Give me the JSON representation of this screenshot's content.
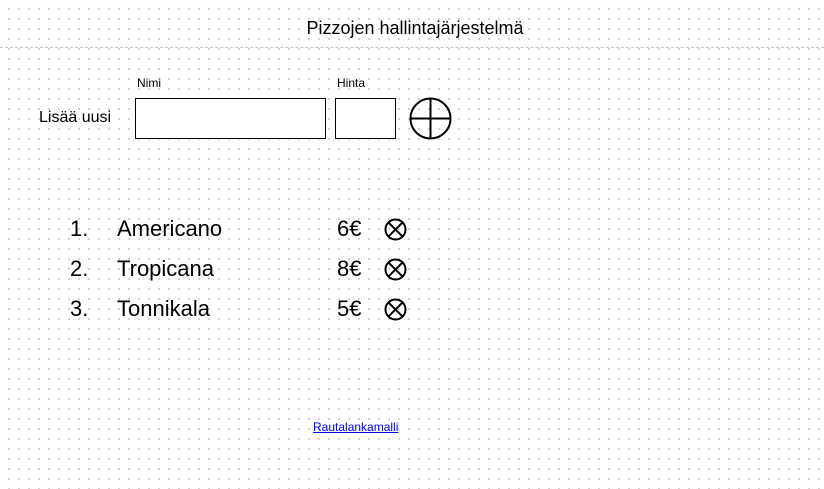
{
  "header": {
    "title": "Pizzojen hallintajärjestelmä"
  },
  "add_form": {
    "label": "Lisää uusi",
    "name_label": "Nimi",
    "name_value": "",
    "price_label": "Hinta",
    "price_value": "",
    "add_icon": "circle-plus-icon"
  },
  "pizzas": [
    {
      "number": "1.",
      "name": "Americano",
      "price": "6€",
      "delete_icon": "circle-x-icon"
    },
    {
      "number": "2.",
      "name": "Tropicana",
      "price": "8€",
      "delete_icon": "circle-x-icon"
    },
    {
      "number": "3.",
      "name": "Tonnikala",
      "price": "5€",
      "delete_icon": "circle-x-icon"
    }
  ],
  "footer": {
    "link_text": "Rautalankamalli"
  }
}
